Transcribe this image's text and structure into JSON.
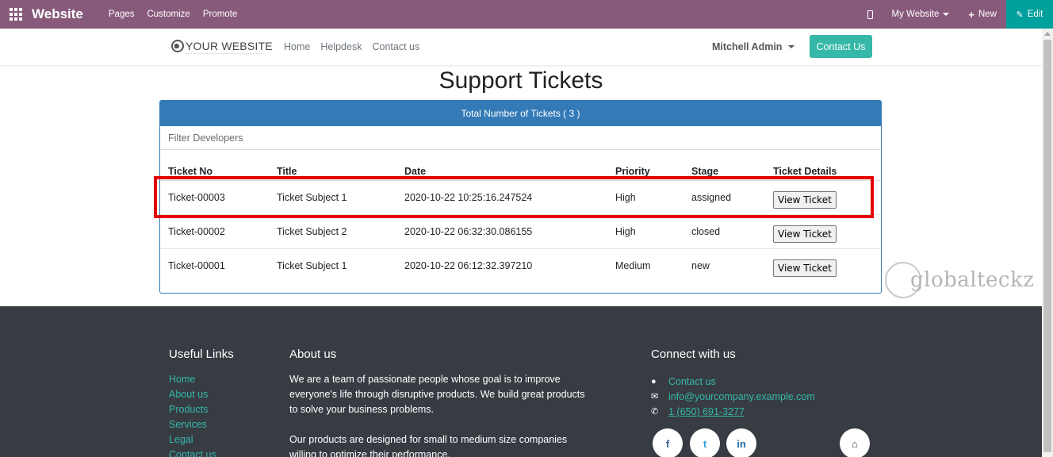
{
  "topbar": {
    "brand": "Website",
    "menu": [
      "Pages",
      "Customize",
      "Promote"
    ],
    "my_website": "My Website",
    "new_label": "New",
    "edit_label": "Edit"
  },
  "header": {
    "logo_text": "YOUR WEBSITE",
    "nav": [
      "Home",
      "Helpdesk",
      "Contact us"
    ],
    "user": "Mitchell Admin",
    "contact_button": "Contact Us"
  },
  "main": {
    "title": "Support Tickets",
    "panel_heading": "Total Number of Tickets ( 3 )",
    "filter_label": "Filter Developers",
    "columns": [
      "Ticket No",
      "Title",
      "Date",
      "Priority",
      "Stage",
      "Ticket Details"
    ],
    "rows": [
      {
        "ticket_no": "Ticket-00003",
        "title": "Ticket Subject 1",
        "date": "2020-10-22 10:25:16.247524",
        "priority": "High",
        "stage": "assigned",
        "action": "View Ticket"
      },
      {
        "ticket_no": "Ticket-00002",
        "title": "Ticket Subject 2",
        "date": "2020-10-22 06:32:30.086155",
        "priority": "High",
        "stage": "closed",
        "action": "View Ticket"
      },
      {
        "ticket_no": "Ticket-00001",
        "title": "Ticket Subject 1",
        "date": "2020-10-22 06:12:32.397210",
        "priority": "Medium",
        "stage": "new",
        "action": "View Ticket"
      }
    ]
  },
  "watermark": "globalteckz",
  "footer": {
    "useful_links_title": "Useful Links",
    "useful_links": [
      "Home",
      "About us",
      "Products",
      "Services",
      "Legal",
      "Contact us"
    ],
    "about_title": "About us",
    "about_p1": "We are a team of passionate people whose goal is to improve everyone's life through disruptive products. We build great products to solve your business problems.",
    "about_p2": "Our products are designed for small to medium size companies willing to optimize their performance.",
    "connect_title": "Connect with us",
    "contact_link": "Contact us",
    "email": "info@yourcompany.example.com",
    "phone": "1 (650) 691-3277",
    "social": [
      "f",
      "t",
      "in"
    ]
  },
  "colors": {
    "topbar": "#875a7b",
    "edit": "#00a09d",
    "accent": "#35b8a7",
    "panel": "#337ab7",
    "highlight": "#e60000",
    "footer": "#373c43"
  },
  "icons": [
    "apps-icon",
    "mobile-icon",
    "plus-icon",
    "pencil-icon",
    "globe-icon",
    "comment-icon",
    "envelope-icon",
    "phone-icon",
    "facebook-icon",
    "twitter-icon",
    "linkedin-icon",
    "home-icon"
  ]
}
